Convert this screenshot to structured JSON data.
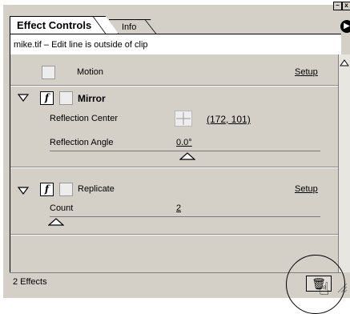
{
  "window": {
    "minimize_glyph": "–",
    "close_glyph": "x"
  },
  "tabs": [
    {
      "label": "Effect Controls",
      "active": true
    },
    {
      "label": "Info",
      "active": false
    }
  ],
  "panel_menu_icon": "arrow-right-icon",
  "clip_info": "mike.tif – Edit line is outside of clip",
  "effects": [
    {
      "name": "Motion",
      "setup_label": "Setup",
      "has_fx": false
    },
    {
      "name": "Mirror",
      "expanded": true,
      "fx_glyph": "f",
      "params": [
        {
          "label": "Reflection Center",
          "value": "(172, 101)",
          "icon": "crosshair-icon"
        },
        {
          "label": "Reflection Angle",
          "value": "0.0°"
        }
      ]
    },
    {
      "name": "Replicate",
      "expanded": true,
      "fx_glyph": "f",
      "setup_label": "Setup",
      "params": [
        {
          "label": "Count",
          "value": "2"
        }
      ]
    }
  ],
  "footer": {
    "status": "2 Effects",
    "trash_icon": "trash-icon",
    "cursor_icon": "hand-pointer-icon"
  }
}
